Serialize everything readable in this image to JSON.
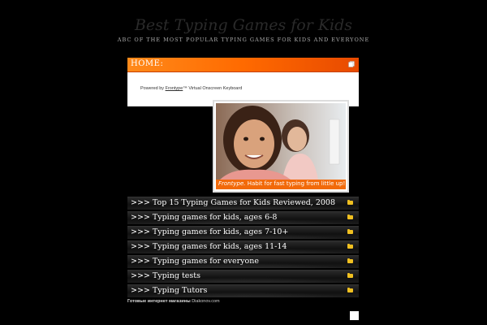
{
  "header": {
    "site_title": "Best Typing Games for Kids",
    "tagline": "ABC OF THE MOST POPULAR TYPING GAMES FOR KIDS AND EVERYONE"
  },
  "home": {
    "title": "HOME:",
    "powered_prefix": "Powered by ",
    "powered_link": "Frontype",
    "powered_suffix": "™ Virtual Onscreen Keyboard"
  },
  "banner": {
    "brand": "Frontype.",
    "slogan": " Habit for fast typing from little up!"
  },
  "nav": {
    "items": [
      {
        "label": ">>> Top 15 Typing Games for Kids Reviewed, 2008"
      },
      {
        "label": ">>> Typing games for kids, ages 6-8"
      },
      {
        "label": ">>> Typing games for kids, ages 7-10+"
      },
      {
        "label": ">>> Typing games for kids, ages 11-14"
      },
      {
        "label": ">>> Typing games for everyone"
      },
      {
        "label": ">>> Typing tests"
      },
      {
        "label": ">>> Typing Tutors"
      }
    ]
  },
  "footer": {
    "shop_text": "Готовые интернет магазины",
    "site_text": " Diakonov.com"
  },
  "colors": {
    "accent": "#ff6a00",
    "background": "#000000",
    "folder": "#f0c020"
  }
}
